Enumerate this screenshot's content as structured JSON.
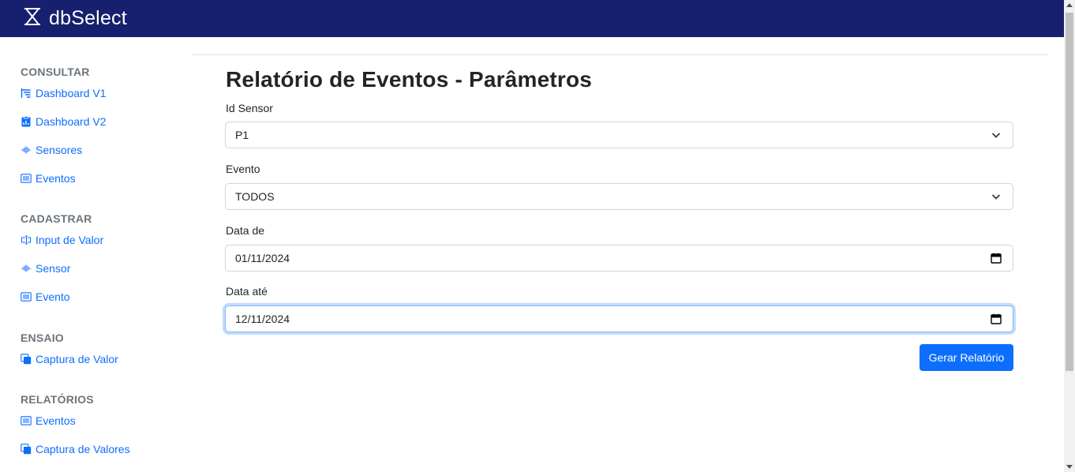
{
  "navbar": {
    "brand": "dbSelect",
    "logo_icon": "hourglass-x-logo-icon",
    "background": "#16206e"
  },
  "sidebar": {
    "sections": [
      {
        "heading": "CONSULTAR",
        "items": [
          {
            "label": "Dashboard V1",
            "icon": "list-tree-icon"
          },
          {
            "label": "Dashboard V2",
            "icon": "clipboard-chart-icon"
          },
          {
            "label": "Sensores",
            "icon": "soundwave-icon"
          },
          {
            "label": "Eventos",
            "icon": "list-box-icon"
          }
        ]
      },
      {
        "heading": "CADASTRAR",
        "items": [
          {
            "label": "Input de Valor",
            "icon": "input-cursor-icon"
          },
          {
            "label": "Sensor",
            "icon": "soundwave-icon"
          },
          {
            "label": "Evento",
            "icon": "list-box-icon"
          }
        ]
      },
      {
        "heading": "ENSAIO",
        "items": [
          {
            "label": "Captura de Valor",
            "icon": "copy-squares-icon"
          }
        ]
      },
      {
        "heading": "RELATÓRIOS",
        "items": [
          {
            "label": "Eventos",
            "icon": "list-box-icon"
          },
          {
            "label": "Captura de Valores",
            "icon": "copy-squares-icon"
          }
        ]
      }
    ]
  },
  "main": {
    "title": "Relatório de Eventos - Parâmetros",
    "fields": {
      "sensor": {
        "label": "Id Sensor",
        "value": "P1",
        "icon": "chevron-down-icon"
      },
      "evento": {
        "label": "Evento",
        "value": "TODOS",
        "icon": "chevron-down-icon"
      },
      "data_de": {
        "label": "Data de",
        "value": "01/11/2024",
        "icon": "calendar-icon"
      },
      "data_ate": {
        "label": "Data até",
        "value": "12/11/2024",
        "icon": "calendar-icon"
      }
    },
    "submit_label": "Gerar Relatório"
  },
  "colors": {
    "accent": "#0d6efd",
    "heading_gray": "#6c757d",
    "navbar": "#16206e"
  }
}
